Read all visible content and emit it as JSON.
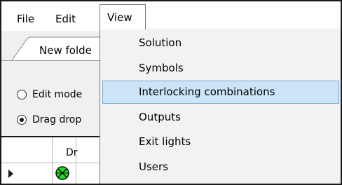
{
  "menubar": {
    "items": [
      "File",
      "Edit",
      "View"
    ]
  },
  "tab": {
    "label": "New folde"
  },
  "modes": {
    "edit_label": "Edit mode",
    "drag_label": "Drag drop"
  },
  "grid": {
    "header_col": "Dr"
  },
  "view_menu": {
    "items": [
      "Solution",
      "Symbols",
      "Interlocking combinations",
      "Outputs",
      "Exit lights",
      "Users"
    ],
    "highlighted": "Interlocking combinations"
  },
  "colors": {
    "highlight_fill": "#cce4f7",
    "highlight_border": "#6aa7db",
    "signal_green": "#22dd22"
  },
  "icons": {
    "row_pointer": "triangle-right-icon",
    "signal": "crossed-circle-signal-icon"
  }
}
